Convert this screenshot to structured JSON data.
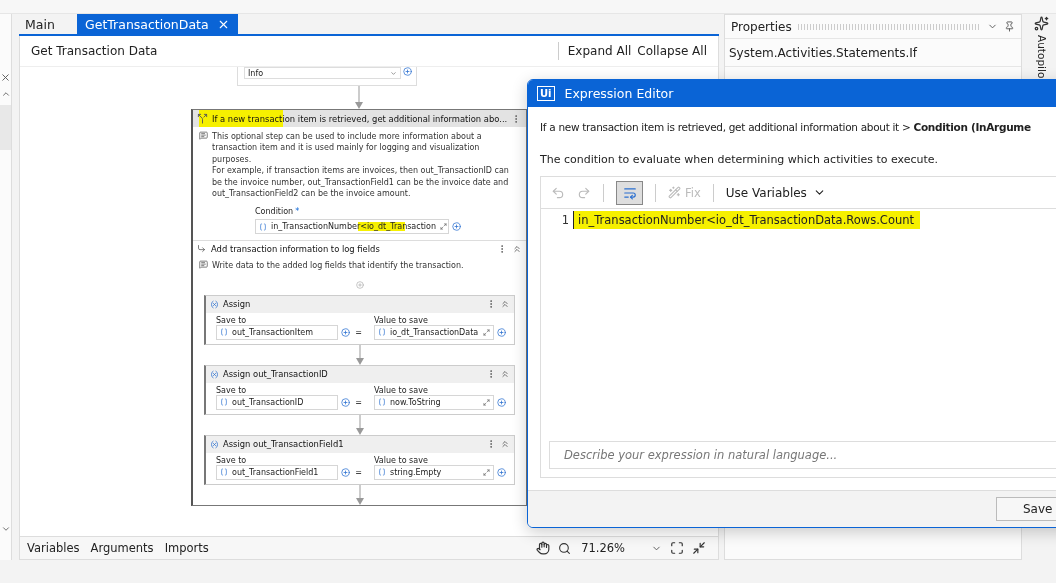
{
  "tabs": [
    {
      "label": "Main",
      "selected": false
    },
    {
      "label": "GetTransactionData",
      "selected": true
    }
  ],
  "designer": {
    "title": "Get Transaction Data",
    "actions": [
      "Expand All",
      "Collapse All"
    ],
    "log_activity": {
      "level_value": "Info"
    },
    "if_activity": {
      "title": "If a new transaction item is retrieved, get additional information abo...",
      "description": "This optional step can be used to include more information about a transaction item and it is used mainly for logging and visualization purposes.\nFor example, if transaction items are invoices, then out_TransactionID can be the invoice number, out_TransactionField1 can be the invoice date and out_TransactionField2 can be the invoice amount.",
      "condition_label": "Condition",
      "required_mark": "*",
      "condition_value": "in_TransactionNumber<io_dt_Transaction",
      "then": {
        "title": "Add transaction information to log fields",
        "description": "Write data to the added log fields that identify the transaction.",
        "activities": [
          {
            "title": "Assign",
            "save_to_label": "Save to",
            "value_label": "Value to save",
            "save_to": "out_TransactionItem",
            "operator": "=",
            "value": "io_dt_TransactionData"
          },
          {
            "title": "Assign out_TransactionID",
            "save_to_label": "Save to",
            "value_label": "Value to save",
            "save_to": "out_TransactionID",
            "operator": "=",
            "value": "now.ToString"
          },
          {
            "title": "Assign out_TransactionField1",
            "save_to_label": "Save to",
            "value_label": "Value to save",
            "save_to": "out_TransactionField1",
            "operator": "=",
            "value": "string.Empty"
          }
        ]
      }
    },
    "bottom_tabs": [
      "Variables",
      "Arguments",
      "Imports"
    ],
    "zoom": "71.26%"
  },
  "properties": {
    "title": "Properties",
    "type": "System.Activities.Statements.If"
  },
  "autopilot": {
    "label": "Autopilo"
  },
  "expression_editor": {
    "logo": "Ui",
    "title": "Expression Editor",
    "breadcrumb": "If a new transaction item is retrieved, get additional information about it",
    "breadcrumb_separator": ">",
    "breadcrumb_current": "Condition (InArgume",
    "description": "The condition to evaluate when determining which activities to execute.",
    "toolbar": {
      "word_wrap_on": true,
      "fix": "Fix",
      "use_variables": "Use Variables"
    },
    "lines": [
      {
        "number": "1",
        "code": "in_TransactionNumber<io_dt_TransactionData.Rows.Count",
        "highlighted": true
      }
    ],
    "nl_placeholder": "Describe your expression in natural language...",
    "save": "Save"
  }
}
